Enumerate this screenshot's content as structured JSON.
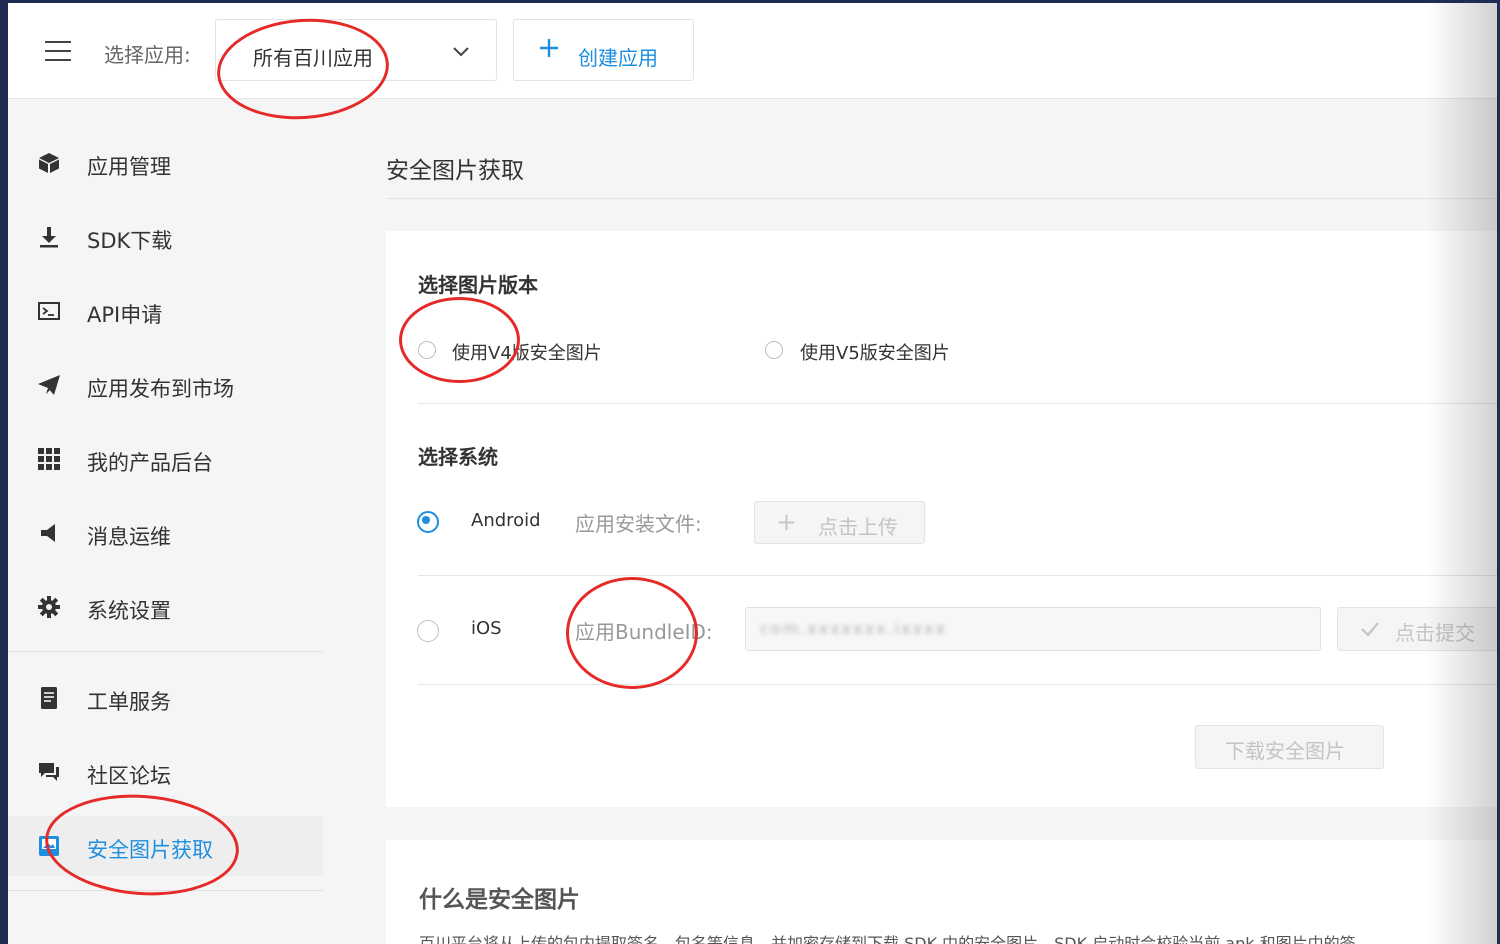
{
  "header": {
    "app_label": "选择应用:",
    "app_select_value": "所有百川应用",
    "create_button": "创建应用"
  },
  "sidebar": {
    "items": [
      {
        "label": "应用管理",
        "icon": "cube-icon"
      },
      {
        "label": "SDK下载",
        "icon": "download-icon"
      },
      {
        "label": "API申请",
        "icon": "terminal-icon"
      },
      {
        "label": "应用发布到市场",
        "icon": "paper-plane-icon"
      },
      {
        "label": "我的产品后台",
        "icon": "grid-icon"
      },
      {
        "label": "消息运维",
        "icon": "megaphone-icon"
      },
      {
        "label": "系统设置",
        "icon": "gear-icon"
      },
      {
        "label": "工单服务",
        "icon": "document-icon"
      },
      {
        "label": "社区论坛",
        "icon": "chat-icon"
      },
      {
        "label": "安全图片获取",
        "icon": "image-icon",
        "active": true
      }
    ]
  },
  "main": {
    "page_title": "安全图片获取",
    "version_section": {
      "title": "选择图片版本",
      "options": [
        "使用V4版安全图片",
        "使用V5版安全图片"
      ]
    },
    "system_section": {
      "title": "选择系统",
      "android_label": "Android",
      "install_file_label": "应用安装文件:",
      "upload_button": "点击上传",
      "ios_label": "iOS",
      "bundle_id_label": "应用BundleID:",
      "bundle_id_value": "com.xxxxxxx.ixxxx",
      "submit_button": "点击提交"
    },
    "download_button": "下载安全图片",
    "info": {
      "title": "什么是安全图片",
      "text": "百川平台将从上传的包内提取签名、包名等信息，并加密存储到下载 SDK 中的安全图片。SDK 启动时会校验当前 apk 和图片中的签"
    }
  },
  "colors": {
    "accent": "#1e8ee0",
    "annotation": "#e52a2a"
  }
}
